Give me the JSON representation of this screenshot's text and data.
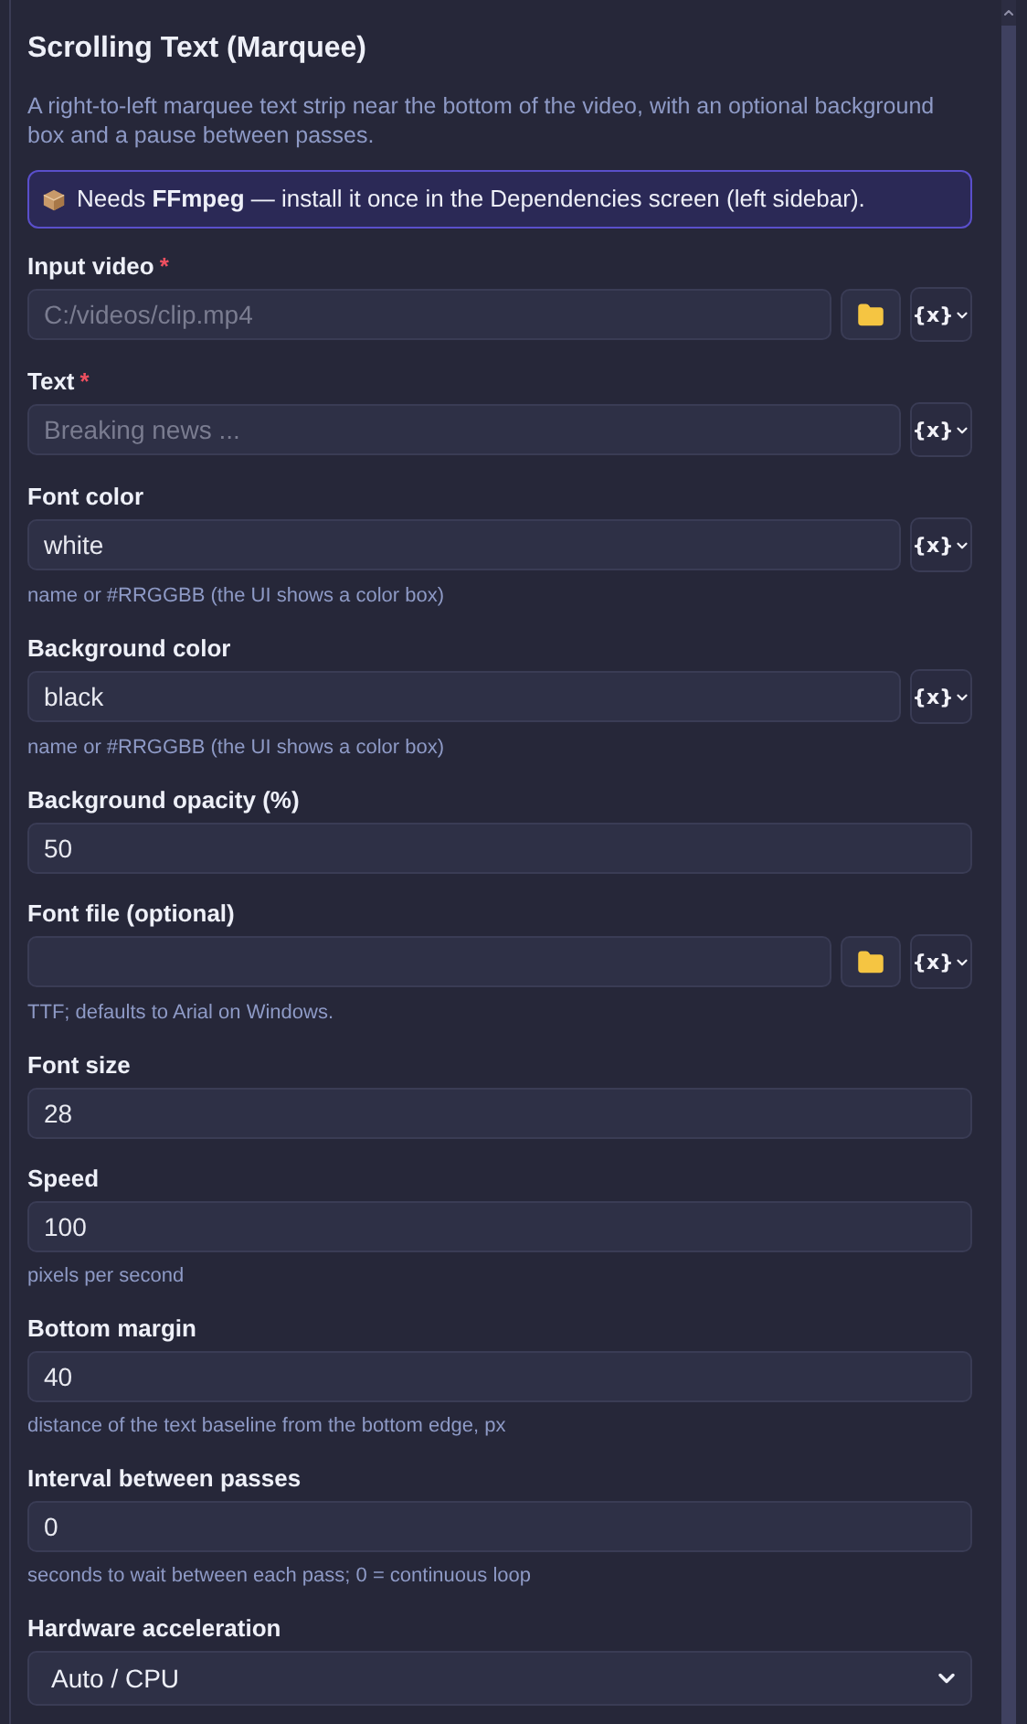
{
  "panel": {
    "title": "Scrolling Text (Marquee)",
    "description": "A right-to-left marquee text strip near the bottom of the video, with an optional background box and a pause between passes.",
    "notice": "Needs **FFmpeg** — install it once in the Dependencies screen (left sidebar).",
    "fields": [
      {
        "kind": "text",
        "label": "Input video",
        "required_mark": "*",
        "placeholder": "C:/videos/clip.mp4",
        "browse": true,
        "variable_label": "{x}"
      },
      {
        "kind": "text",
        "label": "Text",
        "required_mark": "*",
        "placeholder": "Breaking news ...",
        "variable_label": "{x}"
      },
      {
        "kind": "text",
        "label": "Font color",
        "value": "white",
        "variable_label": "{x}",
        "hint": "name or #RRGGBB (the UI shows a color box)"
      },
      {
        "kind": "text",
        "label": "Background color",
        "value": "black",
        "variable_label": "{x}",
        "hint": "name or #RRGGBB (the UI shows a color box)"
      },
      {
        "kind": "text",
        "label": "Background opacity (%)",
        "value": "50"
      },
      {
        "kind": "text",
        "label": "Font file (optional)",
        "browse": true,
        "variable_label": "{x}",
        "hint": "TTF; defaults to Arial on Windows."
      },
      {
        "kind": "text",
        "label": "Font size",
        "value": "28"
      },
      {
        "kind": "text",
        "label": "Speed",
        "value": "100",
        "hint": "pixels per second"
      },
      {
        "kind": "text",
        "label": "Bottom margin",
        "value": "40",
        "hint": "distance of the text baseline from the bottom edge, px"
      },
      {
        "kind": "text",
        "label": "Interval between passes",
        "value": "0",
        "hint": "seconds to wait between each pass; 0 = continuous loop"
      },
      {
        "kind": "select",
        "label": "Hardware acceleration",
        "value": "Auto / CPU"
      }
    ]
  }
}
